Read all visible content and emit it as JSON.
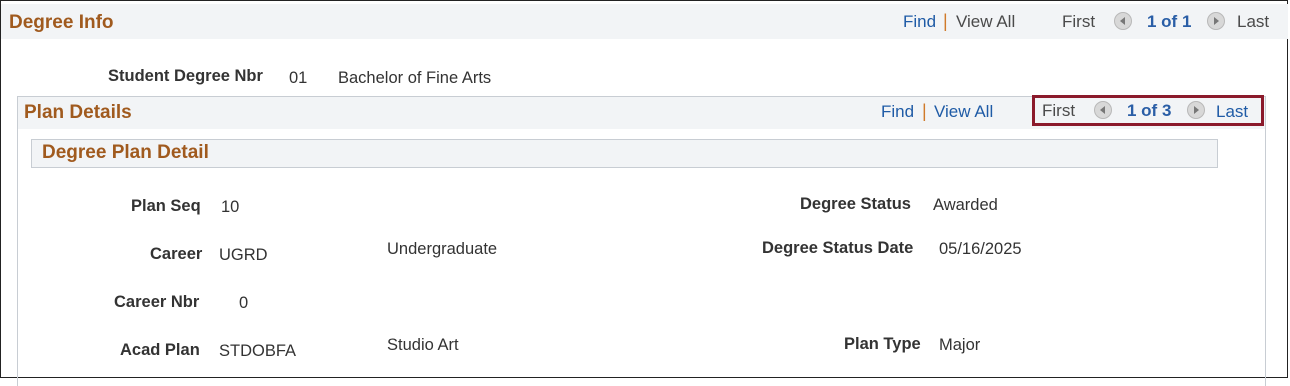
{
  "degree_info": {
    "title": "Degree Info",
    "nav": {
      "find": "Find",
      "view_all": "View All",
      "first": "First",
      "count": "1 of 1",
      "last": "Last"
    }
  },
  "student_degree": {
    "label": "Student Degree Nbr",
    "number": "01",
    "description": "Bachelor of Fine Arts"
  },
  "plan_details": {
    "title": "Plan Details",
    "nav": {
      "find": "Find",
      "view_all": "View All",
      "first": "First",
      "count": "1 of 3",
      "last": "Last"
    }
  },
  "degree_plan_detail": {
    "title": "Degree Plan Detail",
    "plan_seq": {
      "label": "Plan Seq",
      "value": "10"
    },
    "career": {
      "label": "Career",
      "value": "UGRD",
      "description": "Undergraduate"
    },
    "career_nbr": {
      "label": "Career Nbr",
      "value": "0"
    },
    "acad_plan": {
      "label": "Acad Plan",
      "value": "STDOBFA",
      "description": "Studio Art"
    },
    "degree_status": {
      "label": "Degree Status",
      "value": "Awarded"
    },
    "degree_status_date": {
      "label": "Degree Status Date",
      "value": "05/16/2025"
    },
    "plan_type": {
      "label": "Plan Type",
      "value": "Major"
    }
  },
  "icons": {
    "prev": "left-arrow-icon",
    "next": "right-arrow-icon"
  },
  "colors": {
    "title": "#a05a1e",
    "link": "#1f5ba6",
    "highlight": "#8b1a2b",
    "header_bg": "#f2f4f6"
  }
}
